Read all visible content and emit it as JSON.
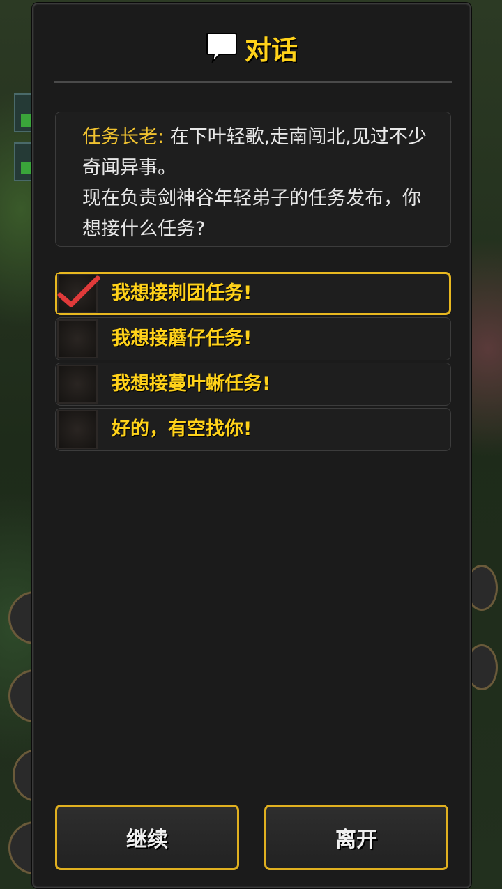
{
  "dialog": {
    "title": "对话",
    "title_icon": "speech-bubble-icon",
    "npc_name": "任务长老:",
    "npc_text_line1": " 在下叶轻歌,走南闯北,见过不少奇闻异事。",
    "npc_text_line2": "现在负责剑神谷年轻弟子的任务发布，你想接什么任务?"
  },
  "options": [
    {
      "label": "我想接刺团任务!",
      "selected": true
    },
    {
      "label": "我想接蘑仔任务!",
      "selected": false
    },
    {
      "label": "我想接蔓叶蜥任务!",
      "selected": false
    },
    {
      "label": "好的，有空找你!",
      "selected": false
    }
  ],
  "buttons": {
    "continue_label": "继续",
    "leave_label": "离开"
  },
  "colors": {
    "accent": "#ffd21a",
    "border_gold": "#e0b020",
    "panel_bg": "#1b1b1b",
    "check_red": "#e03a3a"
  }
}
